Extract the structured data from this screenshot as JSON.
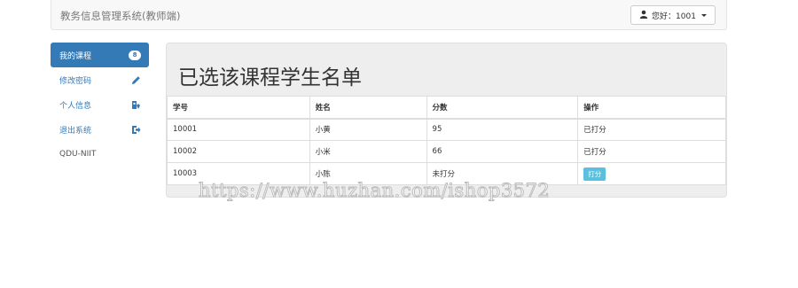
{
  "header": {
    "brand": "教务信息管理系统(教师端)",
    "user_label": "您好：1001",
    "icons": {
      "user": "user-icon",
      "caret": "caret-down-icon"
    }
  },
  "sidebar": {
    "items": [
      {
        "label": "我的课程",
        "badge": "8",
        "active": true,
        "icon": "badge"
      },
      {
        "label": "修改密码",
        "icon": "pencil-icon"
      },
      {
        "label": "个人信息",
        "icon": "user-edit-icon"
      },
      {
        "label": "退出系统",
        "icon": "logout-icon"
      },
      {
        "label": "QDU-NIIT",
        "icon": ""
      }
    ]
  },
  "main": {
    "title": "已选该课程学生名单",
    "table": {
      "headers": [
        "学号",
        "姓名",
        "分数",
        "操作"
      ],
      "rows": [
        {
          "id": "10001",
          "name": "小黄",
          "score": "95",
          "action": "已打分"
        },
        {
          "id": "10002",
          "name": "小米",
          "score": "66",
          "action": "已打分"
        },
        {
          "id": "10003",
          "name": "小陈",
          "score": "未打分",
          "action": "打分"
        }
      ]
    }
  },
  "watermark": "https://www.huzhan.com/ishop3572",
  "colors": {
    "primary": "#337ab7",
    "info": "#5bc0de"
  }
}
